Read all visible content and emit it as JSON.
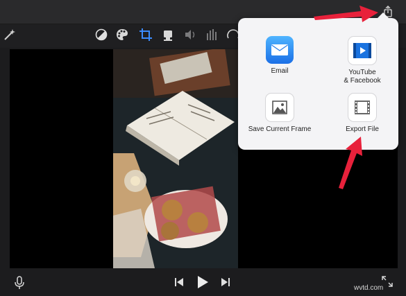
{
  "share_menu": {
    "items": [
      {
        "label": "Email",
        "icon": "email-icon"
      },
      {
        "label": "YouTube\n& Facebook",
        "icon": "youtube-facebook-icon"
      },
      {
        "label": "Save Current Frame",
        "icon": "save-frame-icon"
      },
      {
        "label": "Export File",
        "icon": "export-file-icon"
      }
    ]
  },
  "toolbar": {
    "tools": [
      "magic-wand-icon",
      "color-balance-icon",
      "palette-icon",
      "crop-icon",
      "stabilize-icon",
      "volume-icon",
      "equalizer-icon",
      "speed-icon"
    ],
    "accent_color": "#3b8cff"
  },
  "playback": {
    "controls": [
      "microphone-icon",
      "skip-back-icon",
      "play-icon",
      "skip-forward-icon",
      "fullscreen-icon"
    ]
  },
  "annotations": {
    "arrow_color": "#e8213b"
  },
  "watermark": "wvtd.com"
}
